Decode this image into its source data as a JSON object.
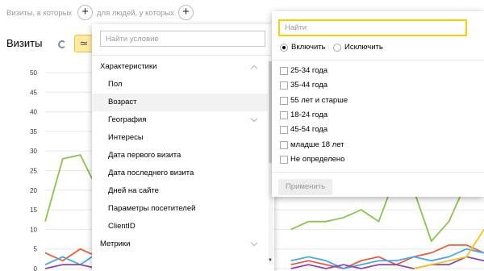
{
  "segment_bar": {
    "visits_label": "Визиты, в которых",
    "people_label": "для людей, у которых",
    "add_label": "+"
  },
  "chart_header": {
    "title": "Визиты",
    "line_toggle_glyph": "≃"
  },
  "condition_dropdown": {
    "search_placeholder": "Найти условие",
    "items": [
      {
        "label": "Характеристики",
        "kind": "group",
        "chevron": "up"
      },
      {
        "label": "Пол",
        "kind": "item"
      },
      {
        "label": "Возраст",
        "kind": "item",
        "selected": true
      },
      {
        "label": "География",
        "kind": "item",
        "chevron": "down"
      },
      {
        "label": "Интересы",
        "kind": "item"
      },
      {
        "label": "Дата первого визита",
        "kind": "item"
      },
      {
        "label": "Дата последнего визита",
        "kind": "item"
      },
      {
        "label": "Дней на сайте",
        "kind": "item"
      },
      {
        "label": "Параметры посетителей",
        "kind": "item"
      },
      {
        "label": "ClientID",
        "kind": "item"
      },
      {
        "label": "Метрики",
        "kind": "group",
        "chevron": "down"
      }
    ]
  },
  "age_dropdown": {
    "search_placeholder": "Найти",
    "include_label": "Включить",
    "exclude_label": "Исключить",
    "include_selected": true,
    "options": [
      "25-34 года",
      "35-44 года",
      "55 лет и старше",
      "18-24 года",
      "45-54 года",
      "младше 18 лет",
      "Не определено"
    ],
    "apply_label": "Применить"
  },
  "icons": {
    "add": "plus-icon",
    "chart_mode": "refresh-icon",
    "line_chart": "line-chart-icon",
    "chevron_up": "chevron-up-icon",
    "chevron_down": "chevron-down-icon",
    "scroll_down": "scroll-down-arrow-icon"
  },
  "colors": {
    "accent_yellow": "#ffcc00",
    "toggle_bg": "#ffeba0"
  },
  "chart_data": {
    "type": "line",
    "ylim": [
      0,
      50
    ],
    "y_ticks": [
      "50",
      "45",
      "40",
      "35",
      "30",
      "25",
      "20",
      "15",
      "10",
      "5",
      "0"
    ],
    "grid": true,
    "series": [
      {
        "color": "#8bc34a",
        "values": [
          12,
          28,
          29,
          20,
          null,
          null,
          null,
          null,
          null,
          null,
          null,
          null,
          null,
          null,
          10,
          12,
          12,
          13,
          15,
          12,
          24,
          20,
          7,
          12,
          22,
          21
        ]
      },
      {
        "color": "#f05a32",
        "values": [
          4,
          2,
          5,
          3,
          null,
          null,
          null,
          null,
          null,
          null,
          null,
          null,
          null,
          null,
          1,
          2,
          1,
          0,
          2,
          3,
          1,
          3,
          4,
          6,
          6,
          4
        ]
      },
      {
        "color": "#3fa9f5",
        "values": [
          1,
          3,
          1,
          4,
          null,
          null,
          null,
          null,
          null,
          null,
          null,
          null,
          null,
          null,
          2,
          3,
          2,
          0,
          1,
          2,
          2,
          3,
          2,
          3,
          5,
          4
        ]
      },
      {
        "color": "#8e44ad",
        "values": [
          0,
          1,
          1,
          0,
          null,
          null,
          null,
          null,
          null,
          null,
          null,
          null,
          null,
          null,
          0,
          1,
          0,
          1,
          0,
          1,
          1,
          0,
          1,
          1,
          3,
          2
        ]
      },
      {
        "color": "#f5c518",
        "values": [
          null,
          null,
          null,
          null,
          null,
          null,
          null,
          null,
          null,
          null,
          null,
          null,
          null,
          null,
          null,
          null,
          null,
          null,
          null,
          null,
          null,
          0,
          1,
          2,
          3,
          10
        ]
      }
    ]
  }
}
